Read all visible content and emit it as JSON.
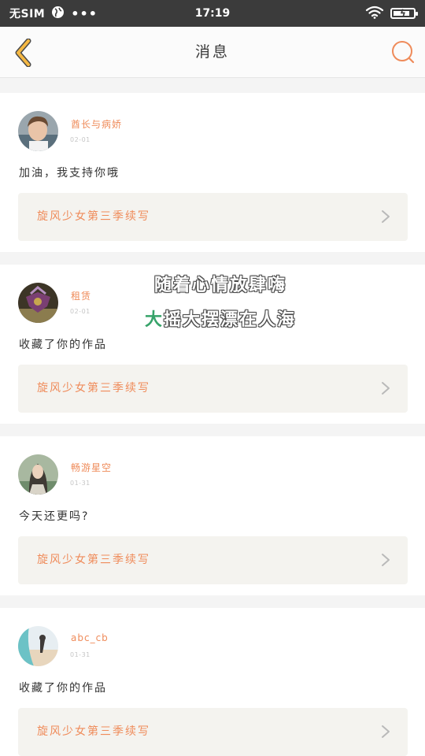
{
  "status_bar": {
    "carrier": "无SIM",
    "dots": "•••",
    "time": "17:19",
    "icons": [
      "vpn-globe-icon",
      "wifi-icon",
      "battery-charging-icon"
    ],
    "battery_level": 0.85
  },
  "header": {
    "title": "消息",
    "back_icon": "chevron-left-icon",
    "search_icon": "search-icon",
    "accent_color": "#ef8b5a",
    "back_color": "#f5b843"
  },
  "messages": [
    {
      "username": "酋长与病娇",
      "date": "02-01",
      "text": "加油，我支持你哦",
      "work_title": "旋风少女第三季续写"
    },
    {
      "username": "租赁",
      "date": "02-01",
      "text": "收藏了你的作品",
      "work_title": "旋风少女第三季续写"
    },
    {
      "username": "畅游星空",
      "date": "01-31",
      "text": "今天还更吗?",
      "work_title": "旋风少女第三季续写"
    },
    {
      "username": "abc_cb",
      "date": "01-31",
      "text": "收藏了你的作品",
      "work_title": "旋风少女第三季续写"
    }
  ],
  "overlay": {
    "line1": "随着心情放肆嗨",
    "line2_prefix": "大",
    "line2": "摇大摆漂在人海"
  }
}
